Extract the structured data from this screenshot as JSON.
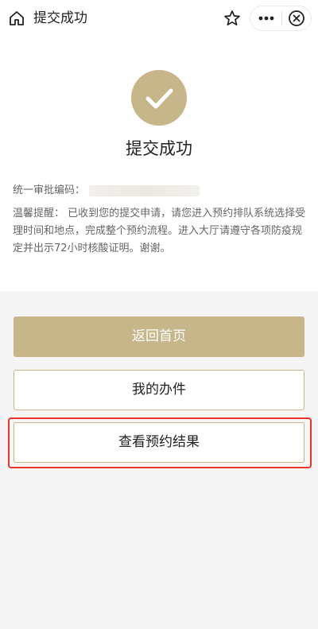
{
  "navbar": {
    "title": "提交成功",
    "home_icon": "home-icon",
    "star_icon": "star-icon",
    "more_icon": "more-icon",
    "more_glyph": "•••",
    "close_icon": "close-icon"
  },
  "result": {
    "status_icon": "checkmark-icon",
    "title": "提交成功",
    "approval_label": "统一审批编码：",
    "reminder_text": "温馨提醒： 已收到您的提交申请，请您进入预约排队系统选择受理时间和地点，完成整个预约流程。进入大厅请遵守各项防疫规定并出示72小时核酸证明。谢谢。"
  },
  "actions": {
    "home_label": "返回首页",
    "my_items_label": "我的办件",
    "view_result_label": "查看预约结果"
  },
  "colors": {
    "accent": "#c6b68a",
    "highlight": "#e8322b",
    "background": "#f5f5f5",
    "text_primary": "#222222",
    "text_secondary": "#666666"
  }
}
